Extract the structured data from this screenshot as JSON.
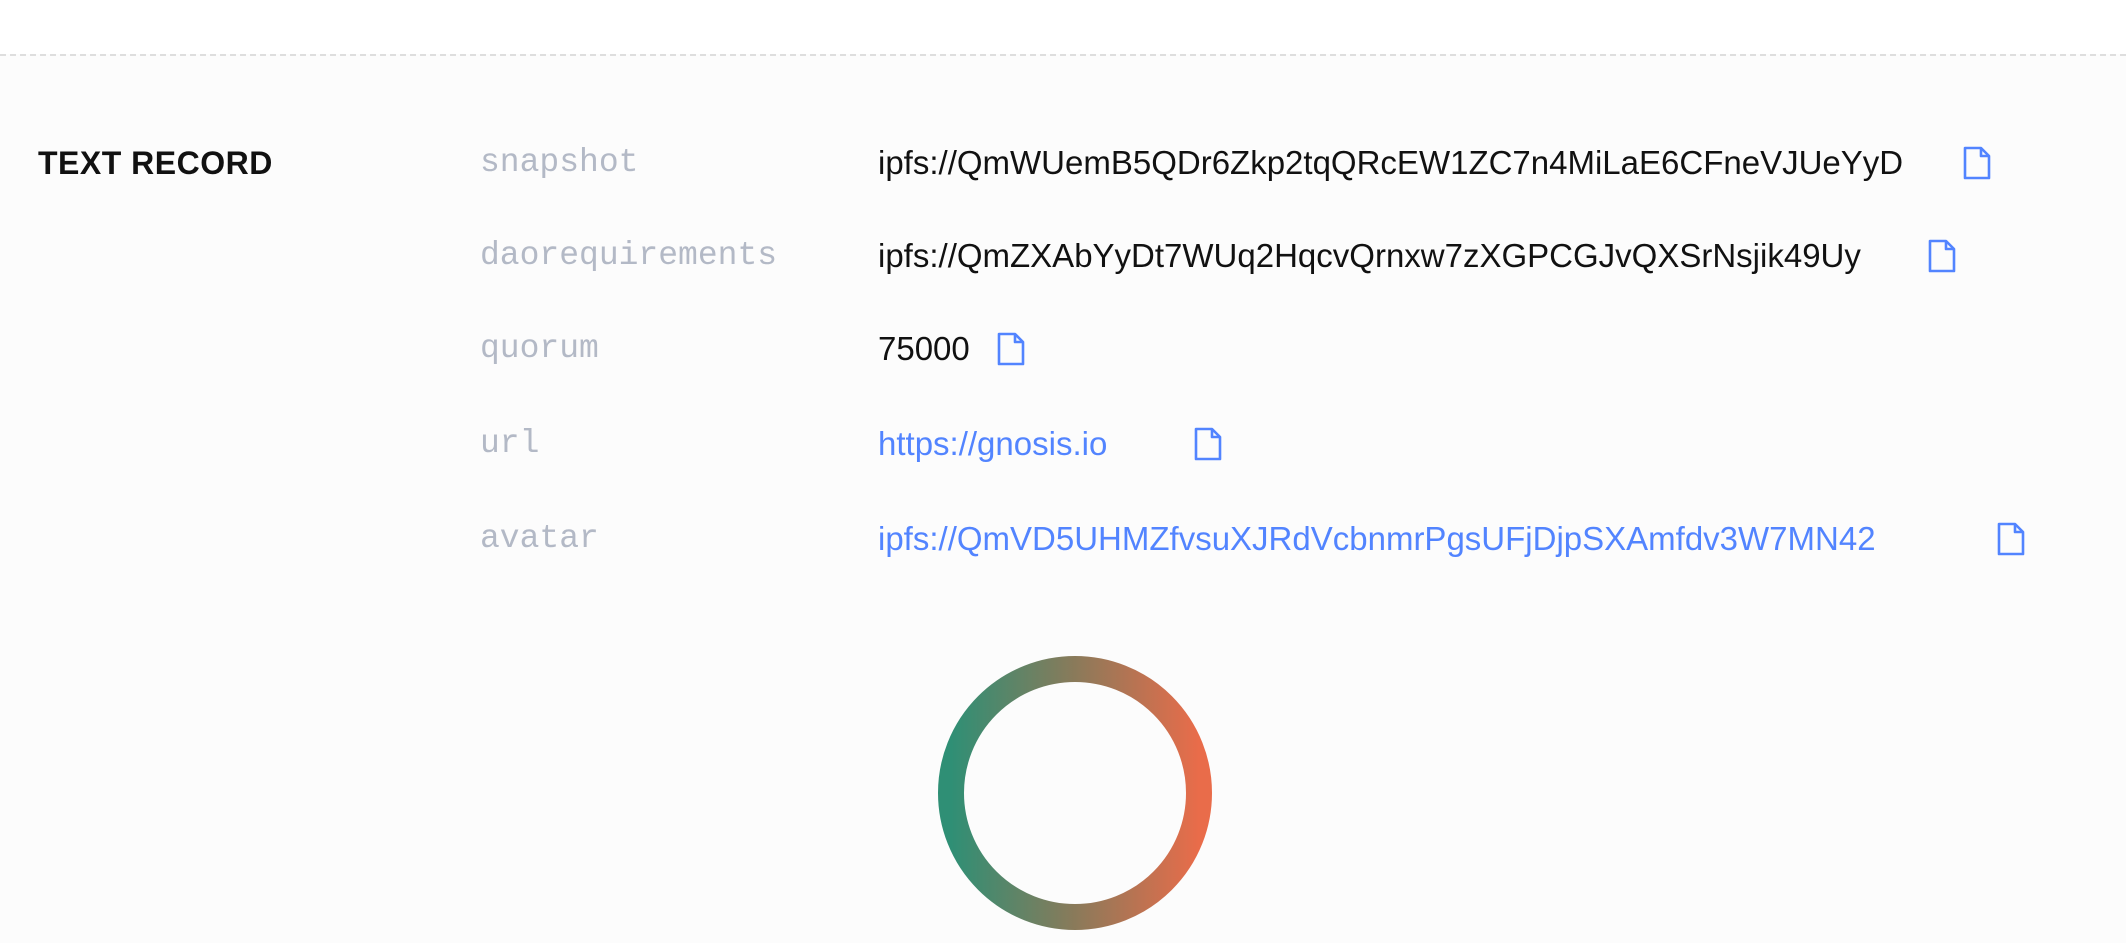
{
  "section": {
    "title": "TEXT RECORD"
  },
  "records": [
    {
      "key": "snapshot",
      "value": "ipfs://QmWUemB5QDr6Zkp2tqQRcEW1ZC7n4MiLaE6CFneVJUeYyD",
      "is_link": false
    },
    {
      "key": "daorequirements",
      "value": "ipfs://QmZXAbYyDt7WUq2HqcvQrnxw7zXGPCGJvQXSrNsjik49Uy",
      "is_link": false
    },
    {
      "key": "quorum",
      "value": "75000",
      "is_link": false
    },
    {
      "key": "url",
      "value": "https://gnosis.io",
      "is_link": true
    },
    {
      "key": "avatar",
      "value": "ipfs://QmVD5UHMZfvsuXJRdVcbnmrPgsUFjDjpSXAmfdv3W7MN42",
      "is_link": true
    }
  ],
  "icons": {
    "copy": "copy-icon",
    "loading": "loading-spinner"
  },
  "colors": {
    "key_text": "#b3b9c6",
    "value_text": "#111111",
    "link": "#5284ff",
    "icon": "#5284ff",
    "spinner_start": "#2f8f75",
    "spinner_end": "#e96c4a"
  }
}
